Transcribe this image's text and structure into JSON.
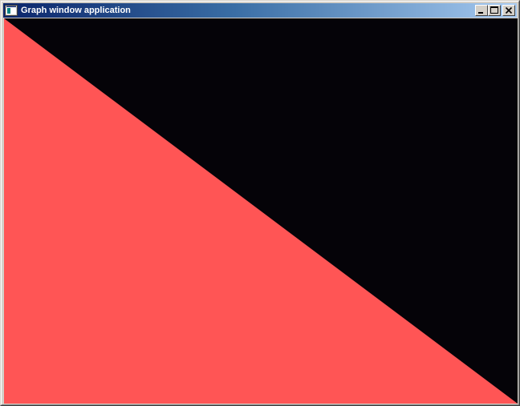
{
  "window": {
    "title": "Graph window application",
    "controls": {
      "minimize": "minimize",
      "maximize": "maximize",
      "close": "close"
    }
  },
  "canvas": {
    "background_color": "#050308",
    "fill_color": "#ff5555",
    "shape": "triangle"
  },
  "icons": {
    "app": "app-window-icon",
    "minimize": "minimize-icon",
    "maximize": "maximize-icon",
    "close": "close-icon"
  }
}
